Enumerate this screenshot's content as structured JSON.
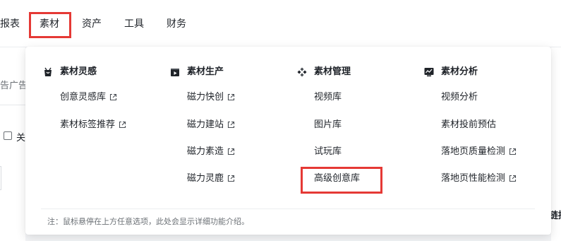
{
  "nav": {
    "items": [
      {
        "label": "报表"
      },
      {
        "label": "素材"
      },
      {
        "label": "资产"
      },
      {
        "label": "工具"
      },
      {
        "label": "财务"
      }
    ]
  },
  "background": {
    "fragment_ad": "告广告有",
    "fragment_toggle": "关",
    "fragment_col": "链接"
  },
  "menu": {
    "columns": [
      {
        "title": "素材灵感",
        "icon": "inspiration-bag-icon",
        "items": [
          {
            "label": "创意灵感库",
            "external": true
          },
          {
            "label": "素材标签推荐",
            "external": true
          }
        ]
      },
      {
        "title": "素材生产",
        "icon": "video-play-icon",
        "items": [
          {
            "label": "磁力快创",
            "external": true
          },
          {
            "label": "磁力建站",
            "external": true
          },
          {
            "label": "磁力素造",
            "external": true
          },
          {
            "label": "磁力灵鹿",
            "external": true
          }
        ]
      },
      {
        "title": "素材管理",
        "icon": "diamond-grid-icon",
        "items": [
          {
            "label": "视频库",
            "external": false
          },
          {
            "label": "图片库",
            "external": false
          },
          {
            "label": "试玩库",
            "external": false
          },
          {
            "label": "高级创意库",
            "external": false
          }
        ]
      },
      {
        "title": "素材分析",
        "icon": "analytics-chart-icon",
        "items": [
          {
            "label": "视频分析",
            "external": false
          },
          {
            "label": "素材投前预估",
            "external": false
          },
          {
            "label": "落地页质量检测",
            "external": true
          },
          {
            "label": "落地页性能检测",
            "external": true
          }
        ]
      }
    ],
    "note": "注：鼠标悬停在上方任意选项，此处会显示详细功能介绍。"
  },
  "colors": {
    "highlight": "#e53935",
    "text": "#1f2329",
    "muted": "#6b7075"
  }
}
